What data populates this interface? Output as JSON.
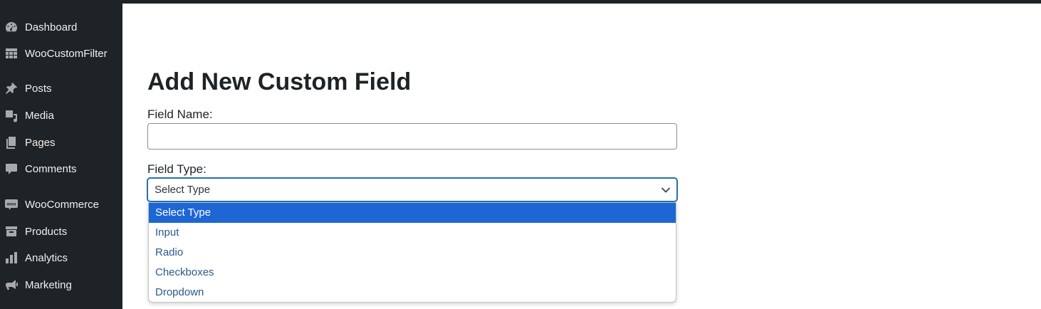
{
  "sidebar": {
    "items": [
      {
        "label": "Dashboard",
        "icon": "dashboard-icon"
      },
      {
        "label": "WooCustomFilter",
        "icon": "table-grid-icon"
      },
      {
        "label": "Posts",
        "icon": "pushpin-icon"
      },
      {
        "label": "Media",
        "icon": "media-icon"
      },
      {
        "label": "Pages",
        "icon": "pages-icon"
      },
      {
        "label": "Comments",
        "icon": "comment-icon"
      },
      {
        "label": "WooCommerce",
        "icon": "woocommerce-icon"
      },
      {
        "label": "Products",
        "icon": "archive-box-icon"
      },
      {
        "label": "Analytics",
        "icon": "bar-chart-icon"
      },
      {
        "label": "Marketing",
        "icon": "megaphone-icon"
      }
    ],
    "woo_icon_text": "woo"
  },
  "main": {
    "title": "Add New Custom Field",
    "field_name_label": "Field Name:",
    "field_name_value": "",
    "field_type_label": "Field Type:",
    "field_type_selected": "Select Type",
    "field_type_options": [
      "Select Type",
      "Input",
      "Radio",
      "Checkboxes",
      "Dropdown"
    ]
  },
  "colors": {
    "sidebar_bg": "#1d2327",
    "accent": "#2271b1",
    "option_highlight": "#1e66d4"
  }
}
